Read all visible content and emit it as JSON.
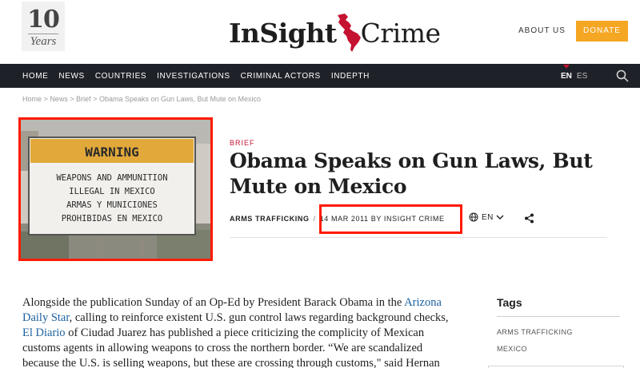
{
  "header": {
    "anniversary_number": "10",
    "anniversary_label": "Years",
    "logo_left": "InSight",
    "logo_right": "Crime",
    "about_label": "ABOUT US",
    "donate_label": "DONATE"
  },
  "nav": {
    "items": [
      "HOME",
      "NEWS",
      "COUNTRIES",
      "INVESTIGATIONS",
      "CRIMINAL ACTORS",
      "INDEPTH"
    ],
    "lang_active": "EN",
    "lang_other": "ES"
  },
  "breadcrumb": {
    "home": "Home",
    "news": "News",
    "brief": "Brief",
    "current": "Obama Speaks on Gun Laws, But Mute on Mexico",
    "separator": ">"
  },
  "featured_image": {
    "sign_header": "WARNING",
    "sign_lines": [
      "WEAPONS AND AMMUNITION",
      "ILLEGAL IN MEXICO",
      "ARMAS Y MUNICIONES",
      "PROHIBIDAS EN MEXICO"
    ]
  },
  "article": {
    "category": "BRIEF",
    "title": "Obama Speaks on Gun Laws, But Mute on Mexico",
    "topic": "ARMS TRAFFICKING",
    "meta_separator": "/",
    "date_byline": "14 MAR 2011 BY INSIGHT CRIME",
    "language": "EN",
    "body": {
      "p1_a": "Alongside the publication Sunday of an Op-Ed by President Barack Obama in the ",
      "p1_link1": "Arizona Daily Star",
      "p1_b": ", calling to reinforce existent U.S. gun control laws regarding background checks, ",
      "p1_link2": "El Diario",
      "p1_c": " of Ciudad Juarez has published a piece criticizing the complicity of Mexican customs agents in allowing weapons to cross the northern border. “We are scandalized because the U.S. is selling weapons, but these are crossing through customs,\" said Hernan"
    }
  },
  "sidebar": {
    "tags_title": "Tags",
    "tags": [
      "ARMS TRAFFICKING",
      "MEXICO"
    ]
  },
  "colors": {
    "brand_red": "#c41230",
    "nav_bg": "#1f2128",
    "donate": "#f5a623",
    "link": "#1a5f9e",
    "highlight_box": "#ff1a00"
  }
}
